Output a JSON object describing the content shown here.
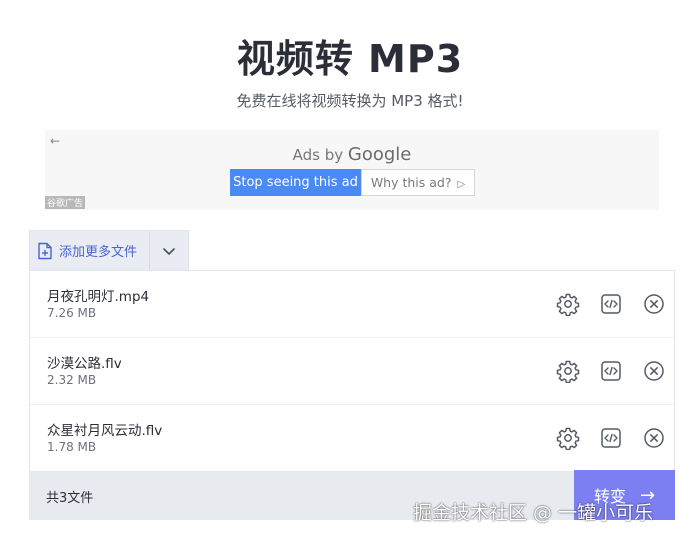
{
  "header": {
    "title": "视频转 MP3",
    "subtitle": "免费在线将视频转换为 MP3 格式!"
  },
  "ad": {
    "back_icon": "←",
    "ads_by": "Ads by",
    "google": "Google",
    "stop_label": "Stop seeing this ad",
    "why_label": "Why this ad?",
    "why_icon": "▷",
    "ad_label": "谷歌广告"
  },
  "add_files": {
    "label": "添加更多文件",
    "icon": "file-plus-icon",
    "dropdown_icon": "chevron-down-icon"
  },
  "files": [
    {
      "name": "月夜孔明灯.mp4",
      "size": "7.26 MB"
    },
    {
      "name": "沙漠公路.flv",
      "size": "2.32 MB"
    },
    {
      "name": "众星衬月风云动.flv",
      "size": "1.78 MB"
    }
  ],
  "footer": {
    "count": "共3文件",
    "convert_label": "转变",
    "convert_icon": "→"
  },
  "watermark": "掘金技术社区 @ 一罐小可乐",
  "colors": {
    "accent": "#7b7ff2",
    "link": "#4a63d6",
    "ad_button": "#4a8af4",
    "footer_bg": "#e7eaef"
  }
}
